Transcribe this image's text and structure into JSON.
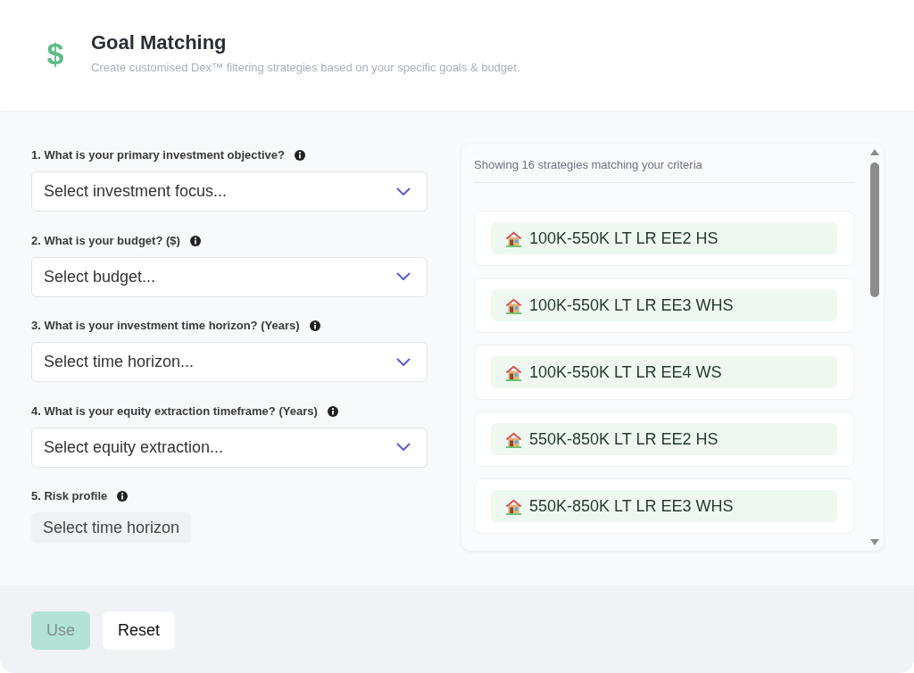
{
  "header": {
    "icon": "$",
    "title": "Goal Matching",
    "subtitle": "Create customised Dex™ filtering strategies based on your specific goals & budget."
  },
  "questions": [
    {
      "kind": "select",
      "label": "1. What is your primary investment objective?",
      "placeholder": "Select investment focus..."
    },
    {
      "kind": "select",
      "label": "2. What is your budget? ($)",
      "placeholder": "Select budget..."
    },
    {
      "kind": "select",
      "label": "3. What is your investment time horizon? (Years)",
      "placeholder": "Select time horizon..."
    },
    {
      "kind": "select",
      "label": "4. What is your equity extraction timeframe? (Years)",
      "placeholder": "Select equity extraction..."
    },
    {
      "kind": "chip",
      "label": "5. Risk profile",
      "text": "Select time horizon"
    }
  ],
  "results": {
    "summary": "Showing 16 strategies matching your criteria",
    "strategies": [
      {
        "label": "100K-550K LT LR EE2 HS"
      },
      {
        "label": "100K-550K LT LR EE3 WHS"
      },
      {
        "label": "100K-550K LT LR EE4 WS"
      },
      {
        "label": "550K-850K LT LR EE2 HS"
      },
      {
        "label": "550K-850K LT LR EE3 WHS"
      }
    ]
  },
  "buttons": [
    {
      "kind": "primary",
      "label": "Use",
      "disabled": true
    },
    {
      "kind": "secondary",
      "label": "Reset",
      "disabled": false
    }
  ]
}
